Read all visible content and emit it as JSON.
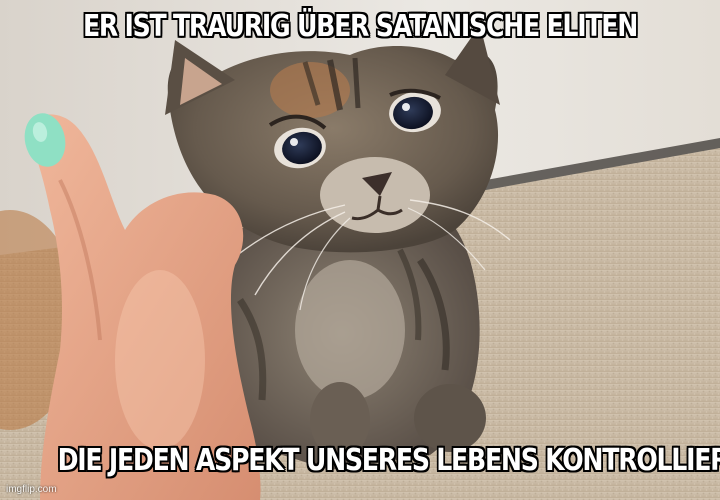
{
  "meme": {
    "top_text": "ER IST TRAURIG ÜBER SATANISCHE ELITEN",
    "bottom_text": "DIE JEDEN ASPEKT UNSERES LEBENS KONTROLLIEREN",
    "watermark": "imgflip.com"
  },
  "photo": {
    "subject": "sad-kitten",
    "elements": [
      "kitten",
      "hand",
      "carpet",
      "wall"
    ]
  },
  "colors": {
    "caption_fill": "#ffffff",
    "caption_outline": "#000000",
    "wall": "#e8e5e0",
    "carpet": "#c8b9a5",
    "skin": "#e3a58a",
    "nail_polish": "#8fe0c4",
    "kitten_fur": "#6f6457"
  }
}
